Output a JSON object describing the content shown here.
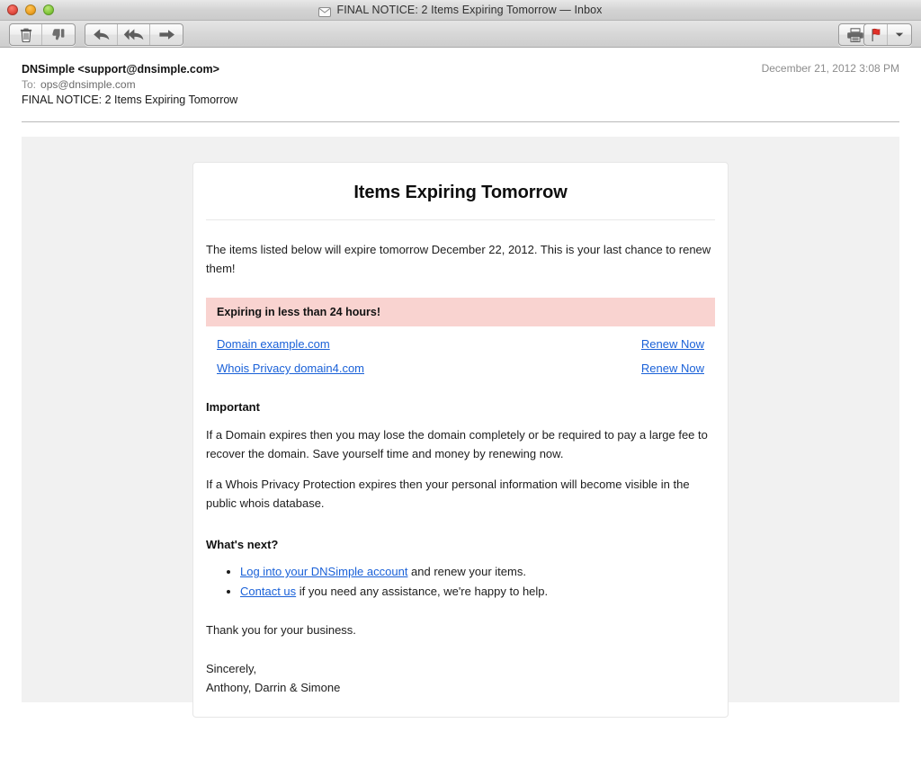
{
  "window": {
    "title": "FINAL NOTICE: 2 Items Expiring Tomorrow — Inbox",
    "title_icon": "envelope-icon",
    "traffic_lights": {
      "close": "close-window-button",
      "minimize": "minimize-window-button",
      "zoom": "zoom-window-button"
    }
  },
  "toolbar": {
    "buttons": [
      {
        "name": "delete-button",
        "icon": "trash-icon"
      },
      {
        "name": "junk-button",
        "icon": "thumbs-down-icon"
      },
      {
        "name": "reply-button",
        "icon": "reply-arrow-icon"
      },
      {
        "name": "reply-all-button",
        "icon": "reply-all-arrow-icon"
      },
      {
        "name": "forward-button",
        "icon": "forward-arrow-icon"
      },
      {
        "name": "print-button",
        "icon": "printer-icon"
      },
      {
        "name": "flag-button",
        "icon": "red-flag-icon"
      },
      {
        "name": "flag-menu-button",
        "icon": "chevron-down-icon"
      }
    ]
  },
  "message_header": {
    "from": "DNSimple <support@dnsimple.com>",
    "to_label": "To:",
    "to_value": "ops@dnsimple.com",
    "subject": "FINAL NOTICE: 2 Items Expiring Tomorrow",
    "date": "December 21, 2012 3:08 PM"
  },
  "email": {
    "title": "Items Expiring Tomorrow",
    "intro": "The items listed below will expire tomorrow December 22, 2012. This is your last chance to renew them!",
    "alert": "Expiring in less than 24 hours!",
    "items": [
      {
        "name": "Domain example.com",
        "action": "Renew Now"
      },
      {
        "name": "Whois Privacy domain4.com",
        "action": "Renew Now"
      }
    ],
    "important_heading": "Important",
    "important_paragraph_1": "If a Domain expires then you may lose the domain completely or be required to pay a large fee to recover the domain. Save yourself time and money by renewing now.",
    "important_paragraph_2": "If a Whois Privacy Protection expires then your personal information will become visible in the public whois database.",
    "next_heading": "What's next?",
    "next_items": [
      {
        "link": "Log into your DNSimple account",
        "rest": " and renew your items."
      },
      {
        "link": "Contact us",
        "rest": " if you need any assistance, we're happy to help."
      }
    ],
    "thanks": "Thank you for your business.",
    "sign_off": "Sincerely,",
    "signature": "Anthony, Darrin & Simone"
  },
  "colors": {
    "link": "#1a61d8",
    "alert_background": "#f9d3d0",
    "body_background": "#f1f1f1",
    "card_background": "#ffffff"
  }
}
